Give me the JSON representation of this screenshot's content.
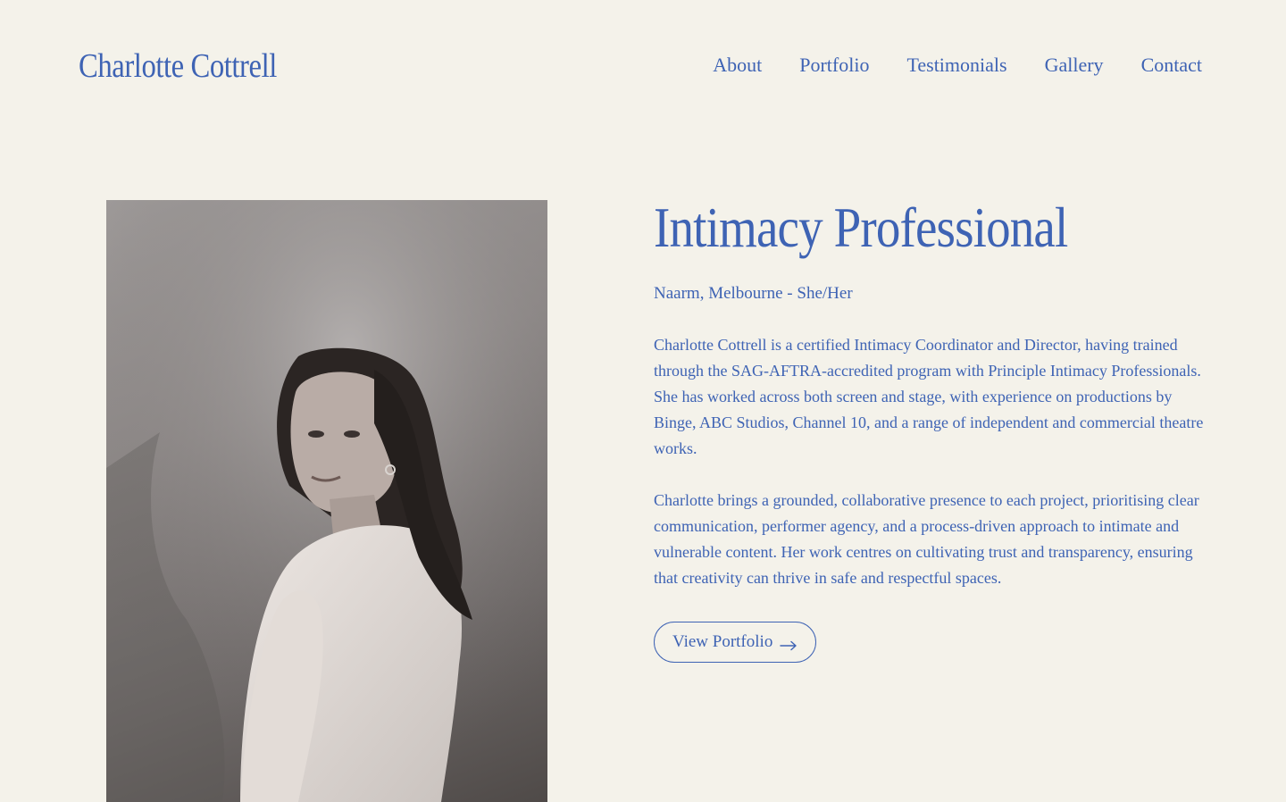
{
  "site": {
    "logo": "Charlotte Cottrell"
  },
  "nav": {
    "items": [
      {
        "label": "About"
      },
      {
        "label": "Portfolio"
      },
      {
        "label": "Testimonials"
      },
      {
        "label": "Gallery"
      },
      {
        "label": "Contact"
      }
    ]
  },
  "hero": {
    "title": "Intimacy Professional",
    "location": "Naarm, Melbourne - She/Her",
    "paragraphs": [
      "Charlotte Cottrell is a certified Intimacy Coordinator and Director, having trained through the SAG-AFTRA-accredited program with Principle Intimacy Professionals. She has worked across both screen and stage, with experience on productions by Binge, ABC Studios, Channel 10, and a range of independent and commercial theatre works.",
      "Charlotte brings a grounded, collaborative presence to each project, prioritising clear communication, performer agency, and a process-driven approach to intimate and vulnerable content. Her work centres on cultivating trust and transparency, ensuring that creativity can thrive in safe and respectful spaces."
    ],
    "cta_label": "View Portfolio"
  },
  "colors": {
    "background": "#f4f2ea",
    "accent": "#3e63b4"
  },
  "icons": {
    "cta": "arrow-right-icon"
  }
}
